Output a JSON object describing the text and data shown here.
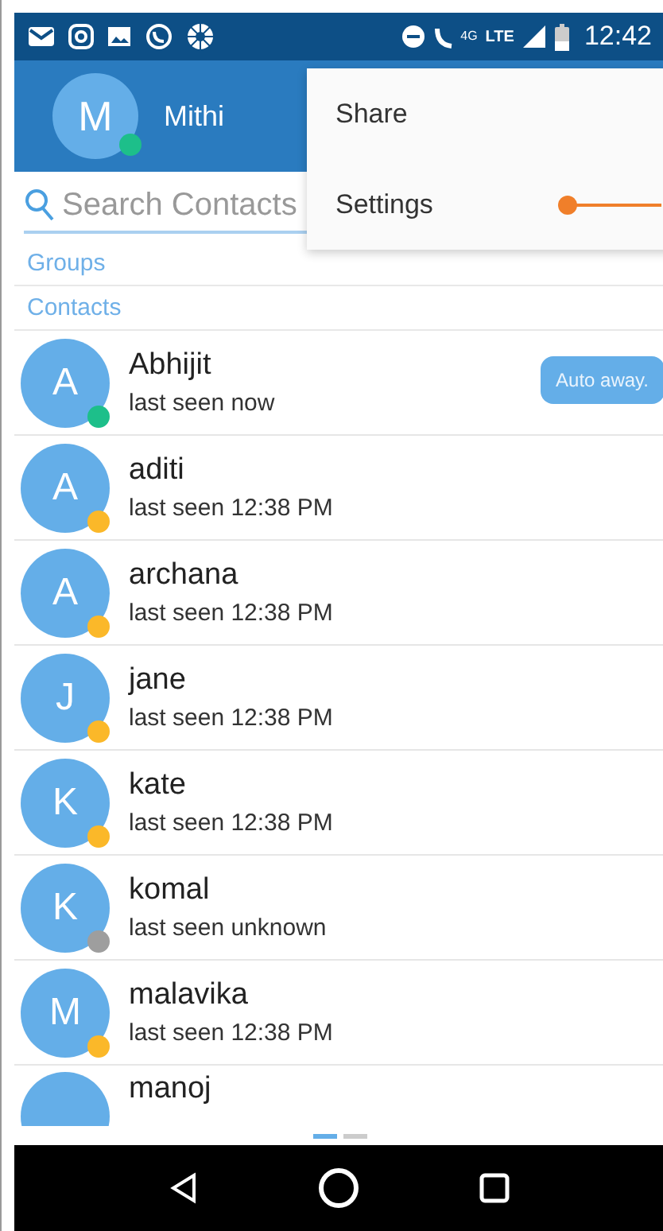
{
  "status_bar": {
    "network_gen": "4G",
    "network": "LTE",
    "time": "12:42"
  },
  "profile": {
    "initial": "M",
    "name": "Mithi",
    "color": "#1dbf8a"
  },
  "menu": [
    {
      "label": "Share",
      "annotated": false
    },
    {
      "label": "Settings",
      "annotated": true
    }
  ],
  "search": {
    "placeholder": "Search Contacts"
  },
  "sections": [
    "Groups",
    "Contacts"
  ],
  "contacts": [
    {
      "initial": "A",
      "name": "Abhijit",
      "status": "last seen now",
      "color": "#1dbf8a",
      "bubble": "Auto away."
    },
    {
      "initial": "A",
      "name": "aditi",
      "status": "last seen 12:38 PM",
      "color": "#fbb829"
    },
    {
      "initial": "A",
      "name": "archana",
      "status": "last seen 12:38 PM",
      "color": "#fbb829"
    },
    {
      "initial": "J",
      "name": "jane",
      "status": "last seen 12:38 PM",
      "color": "#fbb829"
    },
    {
      "initial": "K",
      "name": "kate",
      "status": "last seen 12:38 PM",
      "color": "#fbb829"
    },
    {
      "initial": "K",
      "name": "komal",
      "status": "last seen unknown",
      "color": "#9e9e9e"
    },
    {
      "initial": "M",
      "name": "malavika",
      "status": "last seen 12:38 PM",
      "color": "#fbb829"
    },
    {
      "name": "manoj"
    }
  ],
  "pages": [
    {
      "selected": true
    },
    {
      "selected": false
    }
  ]
}
